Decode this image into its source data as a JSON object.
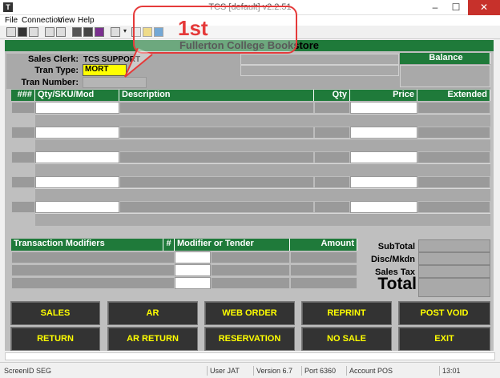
{
  "window": {
    "title": "TCS [default]  v2.2.51",
    "icon": "T",
    "minimize": "–",
    "maximize": "☐",
    "close": "✕"
  },
  "menu": [
    "File",
    "Connection",
    "View",
    "Help"
  ],
  "banner": "Fullerton College Bookstore",
  "header": {
    "sales_clerk_label": "Sales Clerk:",
    "sales_clerk_value": "TCS SUPPORT",
    "tran_type_label": "Tran Type:",
    "tran_type_value": "MORT",
    "tran_number_label": "Tran Number:",
    "balance_label": "Balance"
  },
  "items_table": {
    "columns": [
      "###",
      "Qty/SKU/Mod",
      "Description",
      "Qty",
      "Price",
      "Extended"
    ]
  },
  "modifiers_table": {
    "columns": [
      "Transaction Modifiers",
      "#",
      "Modifier or Tender",
      "Amount"
    ]
  },
  "totals": {
    "subtotal": "SubTotal",
    "disc": "Disc/Mkdn",
    "tax": "Sales Tax",
    "total": "Total"
  },
  "buttons": {
    "sales": "SALES",
    "ar": "AR",
    "web_order": "WEB ORDER",
    "reprint": "REPRINT",
    "post_void": "POST VOID",
    "return": "RETURN",
    "ar_return": "AR RETURN",
    "reservation": "RESERVATION",
    "no_sale": "NO SALE",
    "exit": "EXIT"
  },
  "status": {
    "screen_id": "ScreenID SEG",
    "user": "User JAT",
    "version": "Version 6.7",
    "port": "Port 6360",
    "account": "Account POS",
    "time": "13:01"
  },
  "annotation": {
    "label": "1st",
    "color": "#e53a3a"
  },
  "colors": {
    "banner": "#1f7a3a",
    "button_bg": "#333333",
    "button_text": "#ffff00",
    "highlight": "#ffff00"
  }
}
